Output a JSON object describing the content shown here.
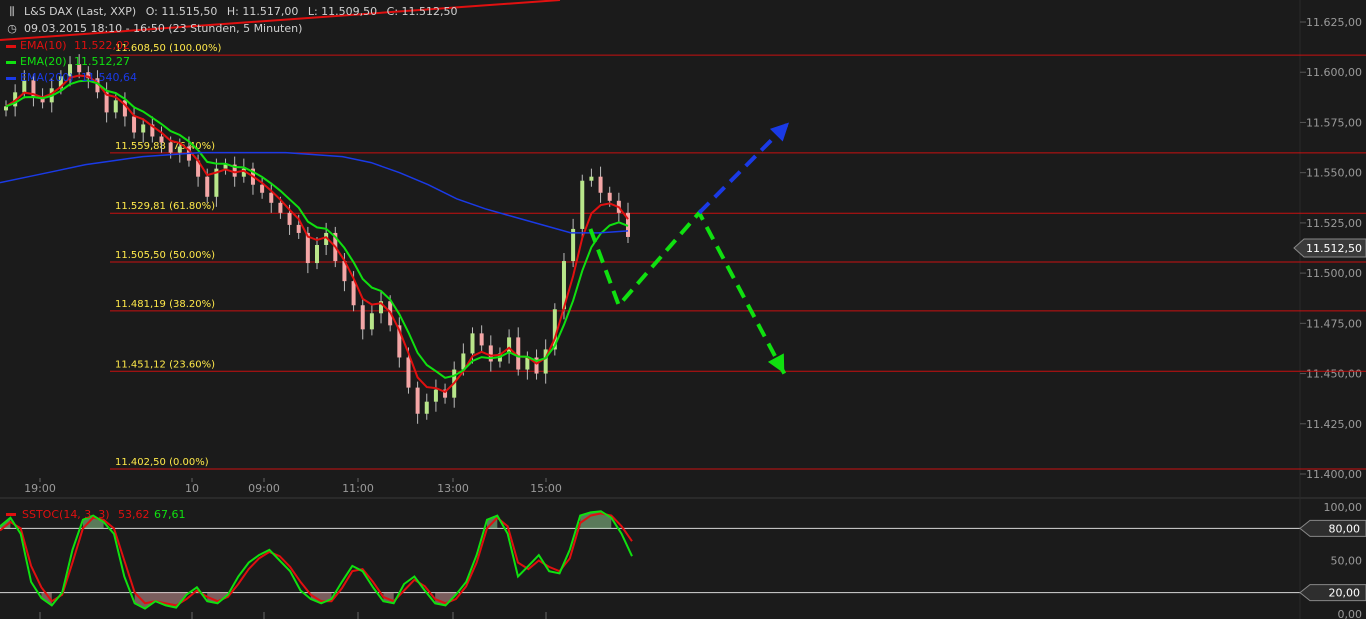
{
  "header": {
    "symbol": "L&S DAX (Last, XXP)",
    "open": "O: 11.515,50",
    "high": "H: 11.517,00",
    "low": "L: 11.509,50",
    "close": "C: 11.512,50",
    "range": "09.03.2015 18:10 - 16:50 (23 Stunden, 5 Minuten)"
  },
  "legend": [
    {
      "label": "EMA(10)",
      "value": "11.522,02",
      "color": "#e01010"
    },
    {
      "label": "EMA(20)",
      "value": "11.512,27",
      "color": "#10e010"
    },
    {
      "label": "EMA(200)",
      "value": "11.540,64",
      "color": "#1a3ae6"
    }
  ],
  "colors": {
    "background": "#1b1b1b",
    "ema10": "#e01010",
    "ema20": "#10e010",
    "ema200": "#1a3ae6",
    "fib_line": "#c81010",
    "fib_text": "#ffe94a",
    "candle_up": "#b8e68a",
    "candle_down": "#f4a6a6",
    "arrow_green": "#10e010",
    "arrow_blue": "#1a3ae6"
  },
  "chart_data": [
    {
      "type": "candlestick",
      "ylim": [
        11400,
        11625
      ],
      "y_ticks": [
        "11.625,00",
        "11.600,00",
        "11.575,00",
        "11.550,00",
        "11.525,00",
        "11.500,00",
        "11.475,00",
        "11.450,00",
        "11.425,00",
        "11.400,00"
      ],
      "y_tick_values": [
        11625,
        11600,
        11575,
        11550,
        11525,
        11500,
        11475,
        11450,
        11425,
        11400
      ],
      "x_ticks": [
        "19:00",
        "10",
        "09:00",
        "11:00",
        "13:00",
        "15:00"
      ],
      "last_price": "11.512,50",
      "last_price_value": 11512.5,
      "fib_levels": [
        {
          "value": 11608.5,
          "label": "11.608,50 (100.00%)"
        },
        {
          "value": 11559.88,
          "label": "11.559,88 (76.40%)"
        },
        {
          "value": 11529.81,
          "label": "11.529,81 (61.80%)"
        },
        {
          "value": 11505.5,
          "label": "11.505,50 (50.00%)"
        },
        {
          "value": 11481.19,
          "label": "11.481,19 (38.20%)"
        },
        {
          "value": 11451.12,
          "label": "11.451,12 (23.60%)"
        },
        {
          "value": 11402.5,
          "label": "11.402,50 (0.00%)"
        }
      ],
      "close_path": [
        11583,
        11590,
        11596,
        11588,
        11585,
        11592,
        11598,
        11604,
        11600,
        11597,
        11590,
        11580,
        11586,
        11578,
        11570,
        11574,
        11568,
        11565,
        11560,
        11563,
        11556,
        11548,
        11538,
        11552,
        11554,
        11548,
        11552,
        11544,
        11540,
        11535,
        11530,
        11524,
        11520,
        11505,
        11514,
        11520,
        11506,
        11496,
        11484,
        11472,
        11480,
        11486,
        11474,
        11458,
        11443,
        11430,
        11436,
        11442,
        11438,
        11452,
        11460,
        11470,
        11464,
        11456,
        11460,
        11468,
        11452,
        11458,
        11450,
        11462,
        11482,
        11506,
        11522,
        11546,
        11548,
        11540,
        11536,
        11530,
        11518
      ],
      "ema200_path": [
        11545,
        11548,
        11551,
        11554,
        11556,
        11558,
        11559,
        11560,
        11560,
        11560,
        11560,
        11559,
        11558,
        11555,
        11550,
        11544,
        11537,
        11532,
        11528,
        11524,
        11520,
        11520,
        11521
      ],
      "scenario_path_green": [
        [
          15.9,
          11522
        ],
        [
          16.5,
          11484
        ],
        [
          18.2,
          11530
        ],
        [
          20.0,
          11450
        ]
      ],
      "scenario_path_blue": [
        [
          18.2,
          11530
        ],
        [
          20.1,
          11575
        ]
      ]
    },
    {
      "type": "line",
      "title": "SSTOC(14, 3, 3)",
      "series": [
        {
          "name": "SSTOC(14, 3, 3)",
          "value_label": "53,62",
          "color": "#e01010"
        },
        {
          "name": "",
          "value_label": "67,61",
          "color": "#10e010"
        }
      ],
      "ylim": [
        0,
        100
      ],
      "y_ticks": [
        "100,00",
        "50,00",
        "0,00"
      ],
      "y_tick_values": [
        100,
        50,
        0
      ],
      "reference_lines": [
        {
          "value": 80,
          "label": "80,00"
        },
        {
          "value": 20,
          "label": "20,00"
        }
      ],
      "k_values": [
        82,
        90,
        75,
        30,
        15,
        8,
        20,
        60,
        88,
        92,
        86,
        75,
        35,
        10,
        5,
        12,
        8,
        6,
        18,
        25,
        12,
        10,
        18,
        35,
        48,
        55,
        60,
        50,
        40,
        22,
        14,
        10,
        14,
        30,
        45,
        40,
        25,
        12,
        10,
        28,
        35,
        22,
        10,
        8,
        18,
        30,
        55,
        88,
        92,
        75,
        35,
        45,
        55,
        40,
        38,
        60,
        92,
        95,
        96,
        90,
        75,
        54
      ],
      "d_values": [
        78,
        86,
        80,
        45,
        25,
        12,
        18,
        48,
        80,
        90,
        88,
        80,
        50,
        20,
        10,
        12,
        10,
        8,
        14,
        22,
        16,
        12,
        16,
        28,
        42,
        52,
        58,
        54,
        44,
        30,
        18,
        12,
        12,
        24,
        40,
        42,
        30,
        16,
        12,
        22,
        32,
        26,
        14,
        10,
        14,
        26,
        48,
        80,
        90,
        82,
        48,
        42,
        50,
        44,
        40,
        52,
        85,
        92,
        94,
        92,
        82,
        68
      ]
    }
  ]
}
